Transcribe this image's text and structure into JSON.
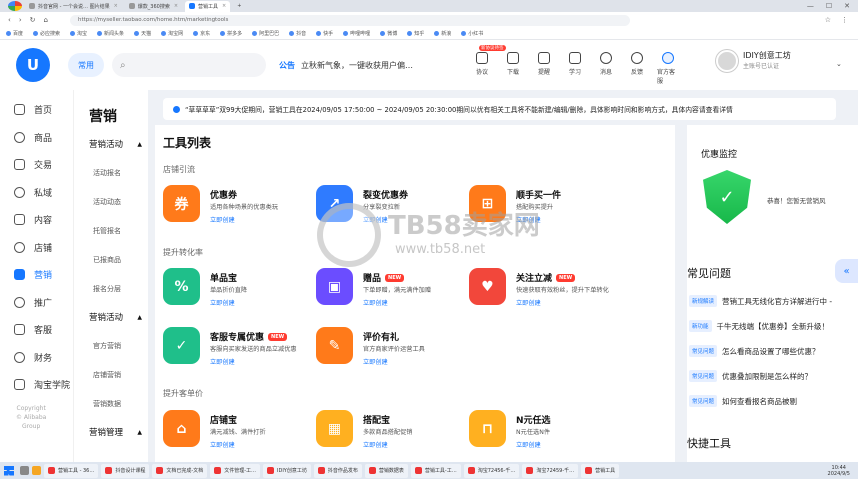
{
  "browser": {
    "tabs": [
      {
        "label": "抖音官网 - 一个会说…  图片结果",
        "active": false
      },
      {
        "label": "爆款_360搜索",
        "active": false
      },
      {
        "label": "营销工具",
        "active": true
      }
    ],
    "tab_close": "×",
    "new_tab": "+",
    "window_controls": [
      "—",
      "☐",
      "✕"
    ],
    "nav_buttons": [
      "‹",
      "›",
      "↻",
      "⌂"
    ],
    "url": "https://myseller.taobao.com/home.htm/marketingtools",
    "addr_tools": [
      "☆",
      "⋮"
    ],
    "bookmarks": [
      "百度",
      "必应搜索",
      "淘宝",
      "新闻头条",
      "天猫",
      "淘宝网",
      "京东",
      "拼多多",
      "阿里巴巴",
      "抖音",
      "快手",
      "哔哩哔哩",
      "微博",
      "知乎",
      "新浪",
      "小红书"
    ]
  },
  "header": {
    "logo_glyph": "U",
    "common_label": "常用",
    "search_icon": "⌕",
    "notice_label": "公告",
    "notice_text": "立秋新气象，一键收获用户偏…",
    "tools": [
      {
        "label": "协议",
        "icon": "document-icon",
        "badge": "新协议待签"
      },
      {
        "label": "下载",
        "icon": "download-icon",
        "badge": ""
      },
      {
        "label": "提醒",
        "icon": "bell-icon",
        "badge": ""
      },
      {
        "label": "学习",
        "icon": "book-icon",
        "badge": ""
      },
      {
        "label": "消息",
        "icon": "message-icon",
        "badge": ""
      },
      {
        "label": "反馈",
        "icon": "feedback-icon",
        "badge": ""
      },
      {
        "label": "官方客服",
        "icon": "service-icon",
        "badge": ""
      }
    ],
    "user_name": "IDIY创意工坊",
    "user_role": "主账号已认证",
    "caret": "⌄"
  },
  "leftnav": {
    "items": [
      {
        "label": "首页",
        "icon": "home-icon",
        "active": false
      },
      {
        "label": "商品",
        "icon": "goods-icon",
        "active": false
      },
      {
        "label": "交易",
        "icon": "trade-icon",
        "active": false
      },
      {
        "label": "私域",
        "icon": "private-icon",
        "active": false
      },
      {
        "label": "内容",
        "icon": "content-icon",
        "active": false
      },
      {
        "label": "店铺",
        "icon": "store-icon",
        "active": false
      },
      {
        "label": "营销",
        "icon": "marketing-icon",
        "active": true
      },
      {
        "label": "推广",
        "icon": "promote-icon",
        "active": false
      },
      {
        "label": "客服",
        "icon": "service-icon",
        "active": false
      },
      {
        "label": "财务",
        "icon": "finance-icon",
        "active": false
      },
      {
        "label": "淘宝学院",
        "icon": "academy-icon",
        "active": false
      }
    ],
    "copyright": [
      "Copyright",
      "© Alibaba",
      "Group"
    ]
  },
  "subnav": {
    "title": "营销",
    "groups": [
      {
        "label": "营销活动",
        "arrow": "▲",
        "items": [
          "活动报名",
          "活动动态",
          "托管报名",
          "已报商品",
          "报名分层"
        ]
      },
      {
        "label": "营销活动",
        "arrow": "▲",
        "items": [
          "官方营销",
          "店铺营销",
          "营销数据"
        ]
      },
      {
        "label": "营销管理",
        "arrow": "▲",
        "items": []
      }
    ]
  },
  "banner": {
    "text": "“草草草草”双99大促期间，营销工具在2024/09/05 17:50:00 ~ 2024/09/05 20:30:00期间以优有相关工具将不能新建/编辑/删除，具体影响时间和影响方式，具体内容请查看详情"
  },
  "main": {
    "title": "工具列表",
    "sections": [
      {
        "label": "店铺引流"
      },
      {
        "label": "提升转化率"
      },
      {
        "label": "提升客单价"
      }
    ],
    "cards": [
      {
        "title": "优惠券",
        "desc": "适用各种场景的优惠类玩",
        "link": "立即创建",
        "color": "orange",
        "glyph": "券",
        "new": false
      },
      {
        "title": "裂变优惠券",
        "desc": "分享裂变拉新",
        "link": "立即创建",
        "color": "blue",
        "glyph": "↗",
        "new": false
      },
      {
        "title": "顺手买一件",
        "desc": "搭配购买提升",
        "link": "立即创建",
        "color": "orange",
        "glyph": "⊞",
        "new": false
      },
      {
        "title": "单品宝",
        "desc": "单品折价直降",
        "link": "立即创建",
        "color": "green",
        "glyph": "%",
        "new": false
      },
      {
        "title": "赠品",
        "desc": "下单即赠，满元满件加赠",
        "link": "立即创建",
        "color": "purple",
        "glyph": "▣",
        "new": true
      },
      {
        "title": "关注立减",
        "desc": "快速获取有效粉丝，提升下单转化",
        "link": "立即创建",
        "color": "red",
        "glyph": "♥",
        "new": true
      },
      {
        "title": "客服专属优惠",
        "desc": "客服向买家发送的商品立减优惠",
        "link": "立即创建",
        "color": "green",
        "glyph": "✓",
        "new": true
      },
      {
        "title": "评价有礼",
        "desc": "官方商家评价运营工具",
        "link": "立即创建",
        "color": "orange",
        "glyph": "✎",
        "new": false
      },
      {
        "title": "店铺宝",
        "desc": "满元减钱、满件打折",
        "link": "立即创建",
        "color": "orange",
        "glyph": "⌂",
        "new": false
      },
      {
        "title": "搭配宝",
        "desc": "多款商品搭配促销",
        "link": "立即创建",
        "color": "yellow",
        "glyph": "▦",
        "new": false
      },
      {
        "title": "N元任选",
        "desc": "N元任选N件",
        "link": "立即创建",
        "color": "yellow",
        "glyph": "⊓",
        "new": false
      }
    ],
    "new_label": "NEW"
  },
  "right": {
    "monitor_title": "优惠监控",
    "monitor_text": "恭喜！您暂无营销风",
    "shield_glyph": "✓",
    "faq_title": "常见问题",
    "faq": [
      {
        "tag": "新规解读",
        "text": "营销工具无线化官方详解进行中 -"
      },
      {
        "tag": "新功能",
        "text": "千牛无线端【优惠券】全新升级！"
      },
      {
        "tag": "常见问题",
        "text": "怎么看商品设置了哪些优惠？"
      },
      {
        "tag": "常见问题",
        "text": "优惠叠加限制是怎么样的？"
      },
      {
        "tag": "常见问题",
        "text": "如何查看报名商品被剔"
      }
    ],
    "quick_title": "快捷工具",
    "float_glyph": "«"
  },
  "watermark": {
    "text": "TB58卖家网",
    "url": "www.tb58.net"
  },
  "taskbar": {
    "tasks": [
      "营销工具 - 36…",
      "抖音设计课程",
      "文档已完成-文档",
      "文件管理-工…",
      "IDIY创意工坊",
      "抖音作品发布",
      "营销数据表",
      "营销工具-工…",
      "淘宝72456-千…",
      "淘宝72459-千…",
      "营销工具"
    ],
    "time": "10:44",
    "date": "2024/9/5"
  }
}
